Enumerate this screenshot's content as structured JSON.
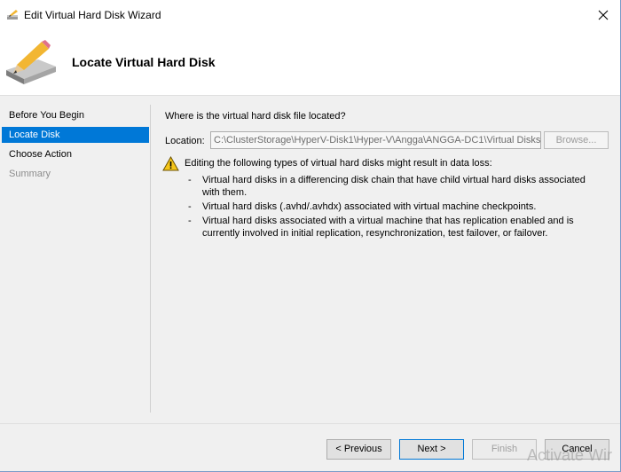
{
  "window": {
    "title": "Edit Virtual Hard Disk Wizard"
  },
  "header": {
    "title": "Locate Virtual Hard Disk"
  },
  "sidebar": {
    "items": [
      {
        "label": "Before You Begin",
        "state": "normal"
      },
      {
        "label": "Locate Disk",
        "state": "active"
      },
      {
        "label": "Choose Action",
        "state": "normal"
      },
      {
        "label": "Summary",
        "state": "disabled"
      }
    ]
  },
  "main": {
    "question": "Where is the virtual hard disk file located?",
    "location_label": "Location:",
    "location_value": "C:\\ClusterStorage\\HyperV-Disk1\\Hyper-V\\Angga\\ANGGA-DC1\\Virtual Disks\\A",
    "browse_label": "Browse...",
    "warning_text": "Editing the following types of virtual hard disks might result in data loss:",
    "bullets": [
      "Virtual hard disks in a differencing disk chain that have child virtual hard disks associated with them.",
      "Virtual hard disks (.avhd/.avhdx) associated with virtual machine checkpoints.",
      "Virtual hard disks associated with a virtual machine that has replication enabled and is currently involved in initial replication, resynchronization, test failover, or failover."
    ],
    "bullet_marker": "-"
  },
  "footer": {
    "previous_label": "< Previous",
    "next_label": "Next >",
    "finish_label": "Finish",
    "cancel_label": "Cancel"
  },
  "watermark": {
    "text": "Activate Wir"
  },
  "colors": {
    "accent": "#0078d7",
    "warning": "#f5c518"
  }
}
